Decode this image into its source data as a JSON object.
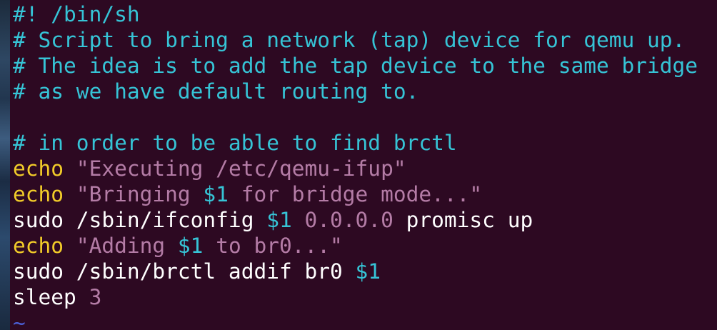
{
  "editor": {
    "lines": [
      [
        {
          "t": "#! /bin/sh",
          "c": "comment"
        }
      ],
      [
        {
          "t": "# Script to bring a network (tap) device for qemu up.",
          "c": "comment"
        }
      ],
      [
        {
          "t": "# The idea is to add the tap device to the same bridge",
          "c": "comment"
        }
      ],
      [
        {
          "t": "# as we have default routing to.",
          "c": "comment"
        }
      ],
      [
        {
          "t": "",
          "c": "plain"
        }
      ],
      [
        {
          "t": "# in order to be able to find brctl",
          "c": "comment"
        }
      ],
      [
        {
          "t": "echo",
          "c": "keyword"
        },
        {
          "t": " ",
          "c": "plain"
        },
        {
          "t": "\"Executing /etc/qemu-ifup\"",
          "c": "string"
        }
      ],
      [
        {
          "t": "echo",
          "c": "keyword"
        },
        {
          "t": " ",
          "c": "plain"
        },
        {
          "t": "\"Bringing ",
          "c": "string"
        },
        {
          "t": "$1",
          "c": "variable"
        },
        {
          "t": " for bridge mode...\"",
          "c": "string"
        }
      ],
      [
        {
          "t": "sudo /sbin/ifconfig ",
          "c": "plain"
        },
        {
          "t": "$1",
          "c": "variable"
        },
        {
          "t": " ",
          "c": "plain"
        },
        {
          "t": "0.0.0.0",
          "c": "number"
        },
        {
          "t": " promisc up",
          "c": "plain"
        }
      ],
      [
        {
          "t": "echo",
          "c": "keyword"
        },
        {
          "t": " ",
          "c": "plain"
        },
        {
          "t": "\"Adding ",
          "c": "string"
        },
        {
          "t": "$1",
          "c": "variable"
        },
        {
          "t": " to br0...\"",
          "c": "string"
        }
      ],
      [
        {
          "t": "sudo /sbin/brctl addif br0 ",
          "c": "plain"
        },
        {
          "t": "$1",
          "c": "variable"
        }
      ],
      [
        {
          "t": "sleep ",
          "c": "plain"
        },
        {
          "t": "3",
          "c": "number"
        }
      ],
      [
        {
          "t": "~",
          "c": "tilde"
        }
      ]
    ]
  },
  "colors": {
    "background": "#2d0922",
    "comment": "#36c4d6",
    "keyword": "#f2cc29",
    "string": "#b47ca6",
    "text": "#ffffff"
  }
}
